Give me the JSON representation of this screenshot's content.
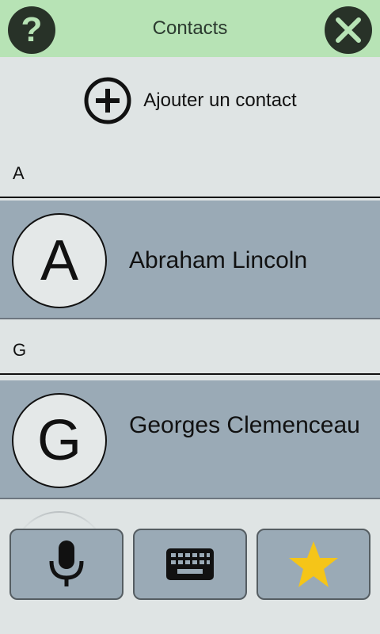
{
  "header": {
    "title": "Contacts",
    "help_icon": "question-mark-icon",
    "close_icon": "close-icon",
    "accent_color": "#b7e3b5"
  },
  "add_contact": {
    "label": "Ajouter un contact",
    "icon": "plus-circle-icon"
  },
  "sections": [
    {
      "letter": "A",
      "contacts": [
        {
          "initial": "A",
          "name": "Abraham Lincoln"
        }
      ]
    },
    {
      "letter": "G",
      "contacts": [
        {
          "initial": "G",
          "name": "Georges Clemenceau"
        }
      ]
    }
  ],
  "toolbar": {
    "buttons": [
      {
        "icon": "microphone-icon"
      },
      {
        "icon": "keyboard-icon"
      },
      {
        "icon": "star-icon",
        "color": "#f5c518"
      }
    ]
  }
}
